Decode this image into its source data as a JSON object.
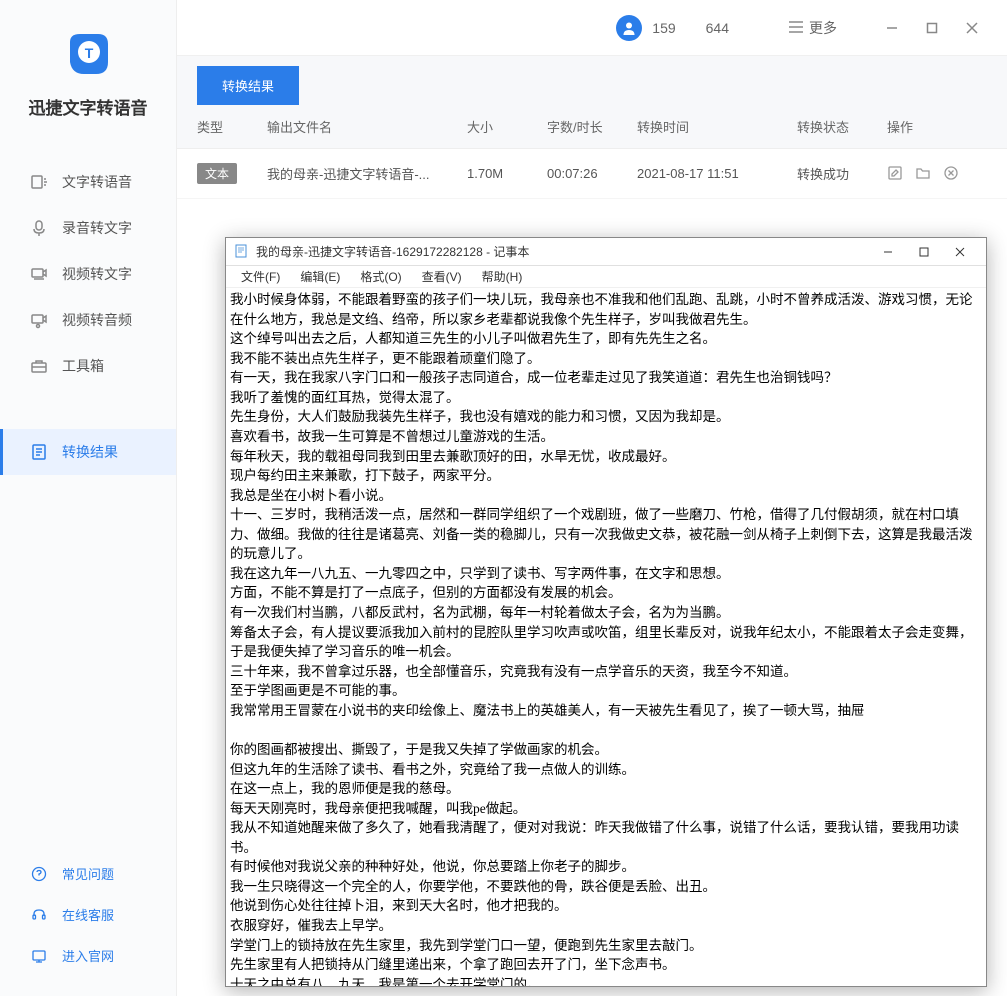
{
  "app": {
    "name": "迅捷文字转语音",
    "logo_letter": "T"
  },
  "sidebar": {
    "items": [
      {
        "label": "文字转语音",
        "icon": "tts"
      },
      {
        "label": "录音转文字",
        "icon": "rec"
      },
      {
        "label": "视频转文字",
        "icon": "video-text"
      },
      {
        "label": "视频转音频",
        "icon": "video-audio"
      },
      {
        "label": "工具箱",
        "icon": "toolbox"
      }
    ],
    "active": {
      "label": "转换结果",
      "icon": "result"
    },
    "bottom": [
      {
        "label": "常见问题",
        "icon": "help"
      },
      {
        "label": "在线客服",
        "icon": "support"
      },
      {
        "label": "进入官网",
        "icon": "website"
      }
    ]
  },
  "topbar": {
    "stat1": "159",
    "stat2": "644",
    "more": "更多"
  },
  "tab_label": "转换结果",
  "table": {
    "headers": {
      "type": "类型",
      "file": "输出文件名",
      "size": "大小",
      "duration": "字数/时长",
      "time": "转换时间",
      "status": "转换状态",
      "ops": "操作"
    },
    "row": {
      "type_badge": "文本",
      "filename": "我的母亲-迅捷文字转语音-...",
      "size": "1.70M",
      "duration": "00:07:26",
      "time": "2021-08-17 11:51",
      "status": "转换成功"
    }
  },
  "notepad": {
    "title": "我的母亲-迅捷文字转语音-1629172282128 - 记事本",
    "menus": [
      "文件(F)",
      "编辑(E)",
      "格式(O)",
      "查看(V)",
      "帮助(H)"
    ],
    "content": "我小时候身体弱，不能跟着野蛮的孩子们一块儿玩，我母亲也不准我和他们乱跑、乱跳，小时不曾养成活泼、游戏习惯，无论在什么地方，我总是文绉、绉帝，所以家乡老辈都说我像个先生样子，岁叫我做君先生。\n这个绰号叫出去之后，人都知道三先生的小儿子叫做君先生了，即有先先生之名。\n我不能不装出点先生样子，更不能跟着顽童们隐了。\n有一天，我在我家八字门口和一般孩子志同道合，成一位老辈走过见了我笑道道：君先生也治铜钱吗？\n我听了羞愧的面红耳热，觉得太混了。\n先生身份，大人们鼓励我装先生样子，我也没有嬉戏的能力和习惯，又因为我却是。\n喜欢看书，故我一生可算是不曾想过儿童游戏的生活。\n每年秋天，我的载祖母同我到田里去兼歌顶好的田，水旱无忧，收成最好。\n现户每约田主来兼歌，打下鼓子，两家平分。\n我总是坐在小树卜看小说。\n十一、三岁时，我稍活泼一点，居然和一群同学组织了一个戏剧班，做了一些磨刀、竹枪，借得了几付假胡须，就在村口填力、做细。我做的往往是诸葛亮、刘备一类的稳脚儿，只有一次我做史文恭，被花融一剑从椅子上刺倒下去，这算是我最活泼的玩意儿了。\n我在这九年一八九五、一九零四之中，只学到了读书、写字两件事，在文字和思想。\n方面，不能不算是打了一点底子，但别的方面都没有发展的机会。\n有一次我们村当鹏，八都反武村，名为武棚，每年一村轮着做太子会，名为为当鹏。\n筹备太子会，有人提议要派我加入前村的昆腔队里学习吹声或吹笛，组里长辈反对，说我年纪太小，不能跟着太子会走变舞，于是我便失掉了学习音乐的唯一机会。\n三十年来，我不曾拿过乐器，也全部懂音乐，究竟我有没有一点学音乐的天资，我至今不知道。\n至于学图画更是不可能的事。\n我常常用王冒蒙在小说书的夹印绘像上、魔法书上的英雄美人，有一天被先生看见了，挨了一顿大骂，抽屉\n\n你的图画都被搜出、撕毁了，于是我又失掉了学做画家的机会。\n但这九年的生活除了读书、看书之外，究竟给了我一点做人的训练。\n在这一点上，我的恩师便是我的慈母。\n每天天刚亮时，我母亲便把我喊醒，叫我pe做起。\n我从不知道她醒来做了多久了，她看我清醒了，便对对我说：昨天我做错了什么事，说错了什么话，要我认错，要我用功读书。\n有时候他对我说父亲的种种好处，他说，你总要踏上你老子的脚步。\n我一生只晓得这一个完全的人，你要学他，不要跌他的骨，跌谷便是丢脸、出丑。\n他说到伤心处往往掉卜泪，来到天大名时，他才把我的。\n衣服穿好，催我去上早学。\n学堂门上的锁持放在先生家里，我先到学堂门口一望，便跑到先生家里去敲门。\n先生家里有人把锁持从门缝里递出来，个拿了跑回去开了门，坐下念声书。\n十天之中总有八、九天，我是第一个去开学堂门的。\n等到先生来了，我肯了身书才回家吃早饭。\n我母亲管怼我最严，他是慈母兼任严父，但他从来不在别人面前骂我一句、打我一下，我做错了事，他只对我一儆忌，我看见了他的严厉眼光便叶往了。\n犯的是小，他等到第二天早晨我眼醒时才叫醒我，犯的事太，他等到晚上人尽食，关了房门。\n先责备我，然后刑罚，或罢跪，或拧我的肉，无论怎样重罚，总不许我哭出声音来。\n他教训儿子不是借出北气，叫别人听的。\n有一个出气周的傍晚，我吃了晚饭，在门口玩，身上只穿着一件单背心。\n这时候我母亲的妹子玉英姨母在我家住，她怕我冷了，拿了一件小衫出来叫我穿上，我不肯穿，她说：穿上"
  }
}
